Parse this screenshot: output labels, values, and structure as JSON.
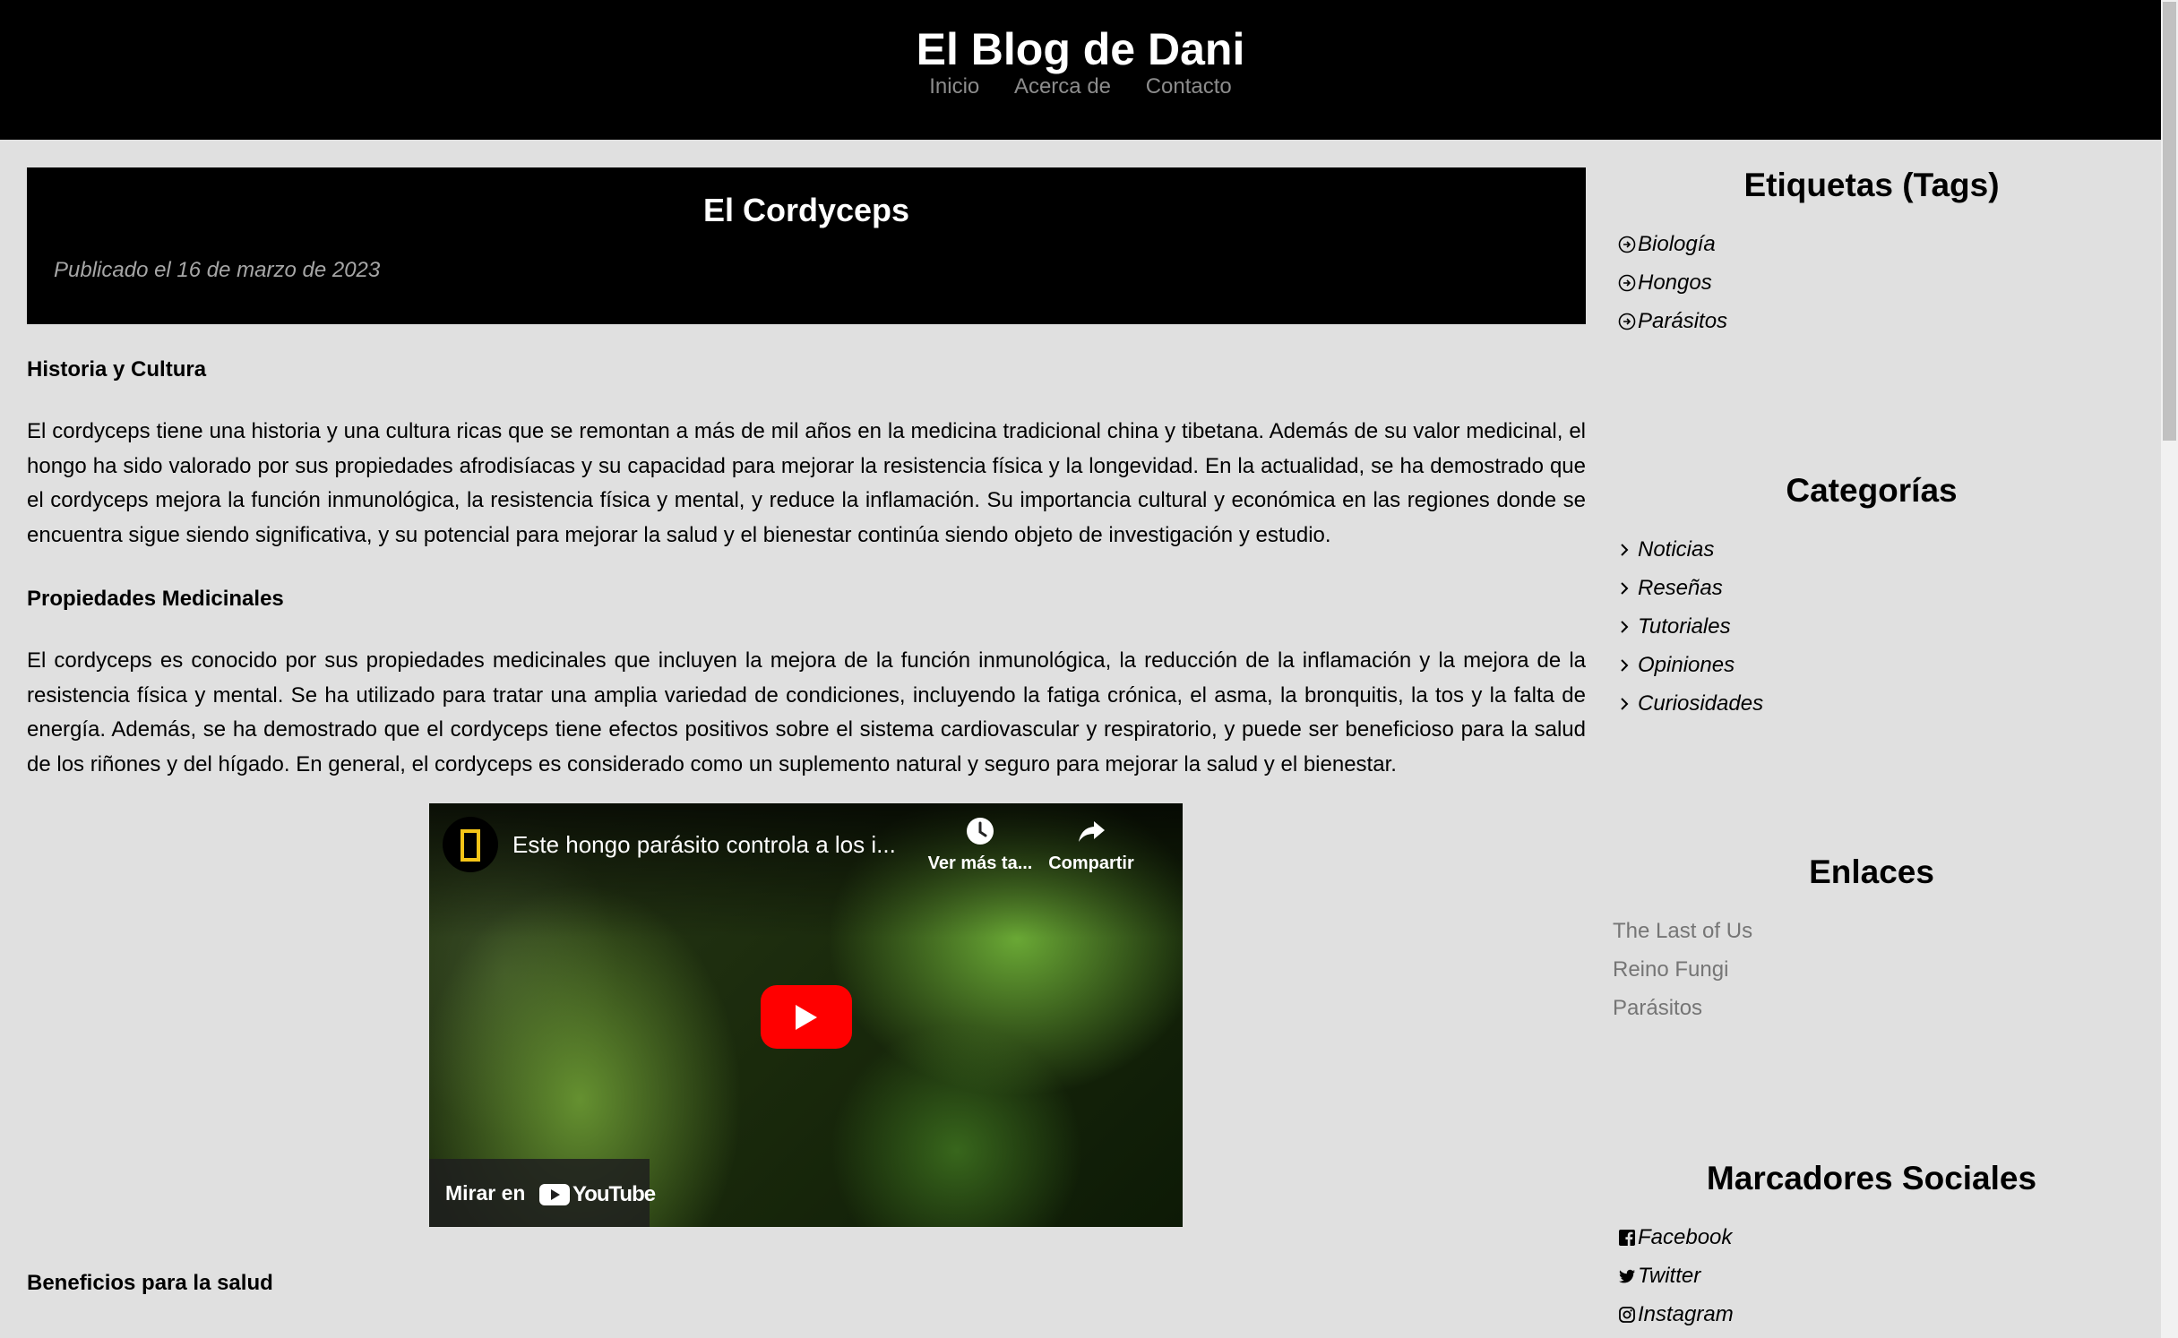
{
  "site": {
    "title": "El Blog de Dani",
    "nav": [
      "Inicio",
      "Acerca de",
      "Contacto"
    ]
  },
  "post": {
    "title": "El Cordyceps",
    "date": "Publicado el 16 de marzo de 2023",
    "sections": [
      {
        "heading": "Historia y Cultura",
        "body": "El cordyceps tiene una historia y una cultura ricas que se remontan a más de mil años en la medicina tradicional china y tibetana. Además de su valor medicinal, el hongo ha sido valorado por sus propiedades afrodisíacas y su capacidad para mejorar la resistencia física y la longevidad. En la actualidad, se ha demostrado que el cordyceps mejora la función inmunológica, la resistencia física y mental, y reduce la inflamación. Su importancia cultural y económica en las regiones donde se encuentra sigue siendo significativa, y su potencial para mejorar la salud y el bienestar continúa siendo objeto de investigación y estudio."
      },
      {
        "heading": "Propiedades Medicinales",
        "body": "El cordyceps es conocido por sus propiedades medicinales que incluyen la mejora de la función inmunológica, la reducción de la inflamación y la mejora de la resistencia física y mental. Se ha utilizado para tratar una amplia variedad de condiciones, incluyendo la fatiga crónica, el asma, la bronquitis, la tos y la falta de energía. Además, se ha demostrado que el cordyceps tiene efectos positivos sobre el sistema cardiovascular y respiratorio, y puede ser beneficioso para la salud de los riñones y del hígado. En general, el cordyceps es considerado como un suplemento natural y seguro para mejorar la salud y el bienestar."
      },
      {
        "heading": "Beneficios para la salud"
      }
    ]
  },
  "video": {
    "title": "Este hongo parásito controla a los i...",
    "watch_later": "Ver más ta...",
    "share": "Compartir",
    "watch_on": "Mirar en",
    "youtube_text": "YouTube",
    "brand_color": "#ff0000",
    "icons": [
      "channel-logo",
      "clock-icon",
      "share-icon",
      "play-icon",
      "youtube-logo"
    ]
  },
  "sidebar": {
    "tags": {
      "heading": "Etiquetas (Tags)",
      "icon": "circle-arrow-right-icon",
      "items": [
        "Biología",
        "Hongos",
        "Parásitos"
      ]
    },
    "categories": {
      "heading": "Categorías",
      "icon": "chevron-right-icon",
      "items": [
        "Noticias",
        "Reseñas",
        "Tutoriales",
        "Opiniones",
        "Curiosidades"
      ]
    },
    "links": {
      "heading": "Enlaces",
      "items": [
        "The Last of Us",
        "Reino Fungi",
        "Parásitos"
      ]
    },
    "social": {
      "heading": "Marcadores Sociales",
      "items": [
        {
          "label": "Facebook",
          "icon": "facebook-icon"
        },
        {
          "label": "Twitter",
          "icon": "twitter-icon"
        },
        {
          "label": "Instagram",
          "icon": "instagram-icon"
        }
      ]
    }
  },
  "colors": {
    "header_bg": "#000000",
    "page_bg": "#e0e0e0",
    "nav_text": "#8c8c8c",
    "date_text": "#a6a6a6",
    "link_text": "#757575"
  }
}
